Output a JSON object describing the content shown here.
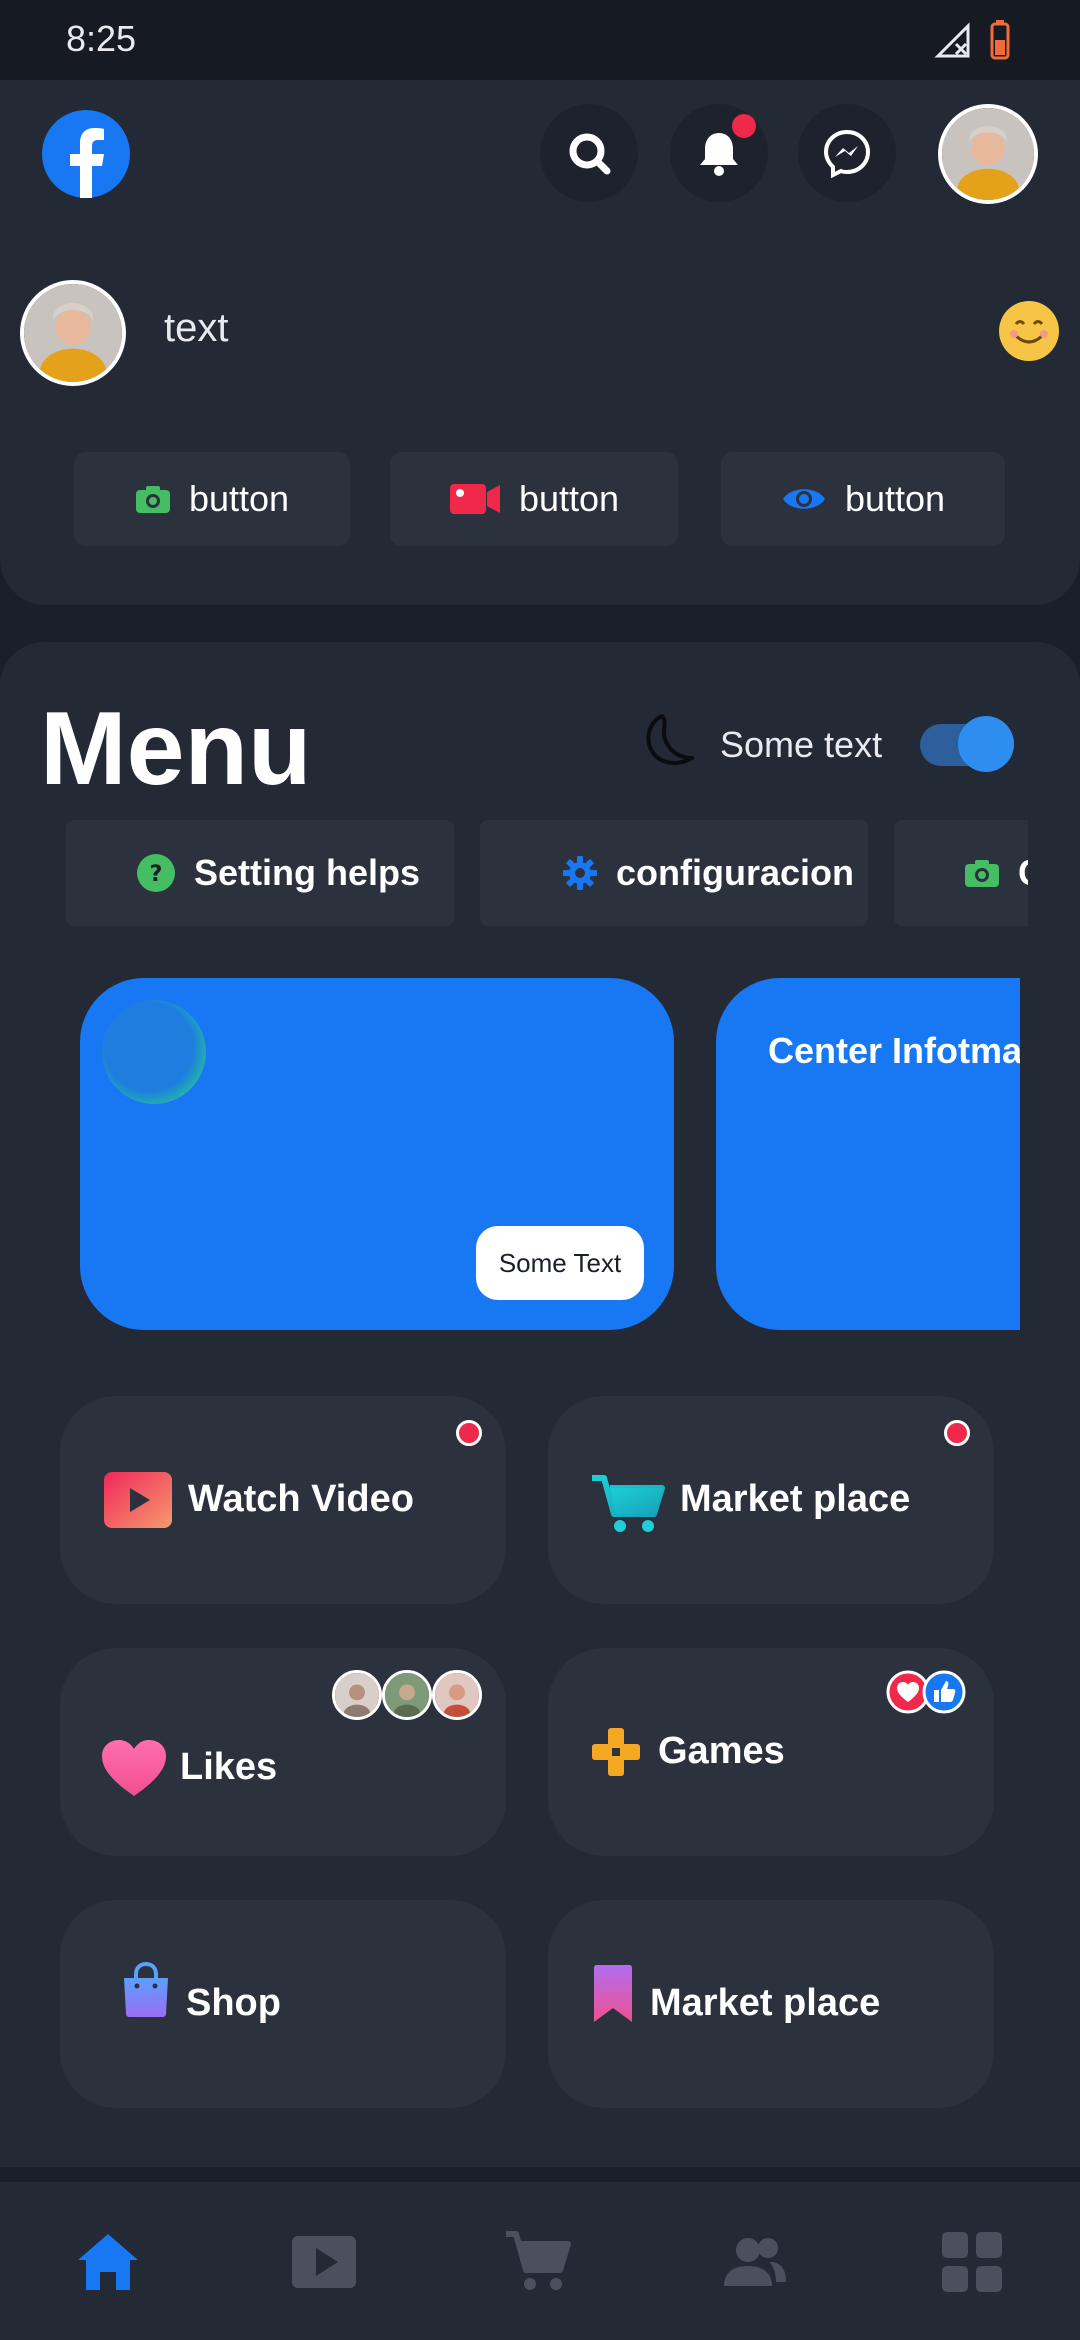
{
  "status_bar": {
    "time": "8:25"
  },
  "header": {
    "post_placeholder_text": "text",
    "actions": [
      {
        "label": "button",
        "icon": "camera-icon",
        "color": "#45bd62"
      },
      {
        "label": "button",
        "icon": "video-camera-icon",
        "color": "#f02849"
      },
      {
        "label": "button",
        "icon": "eye-icon",
        "color": "#1877f2"
      }
    ]
  },
  "menu": {
    "title": "Menu",
    "dark_mode_label": "Some text",
    "dark_mode_on": true,
    "chips": [
      {
        "label": "Setting helps",
        "icon": "help-icon"
      },
      {
        "label": "configuracion",
        "icon": "gear-icon"
      },
      {
        "label": "C",
        "icon": "camera-icon"
      }
    ],
    "banners": [
      {
        "button_label": "Some Text"
      },
      {
        "title": "Center Infotmat"
      }
    ],
    "tiles": [
      {
        "label": "Watch Video",
        "icon": "play-video-icon",
        "badge": true
      },
      {
        "label": "Market place",
        "icon": "shopping-cart-icon",
        "badge": true
      },
      {
        "label": "Likes",
        "icon": "heart-icon"
      },
      {
        "label": "Games",
        "icon": "game-controller-icon"
      },
      {
        "label": "Shop",
        "icon": "shopping-bag-icon"
      },
      {
        "label": "Market place",
        "icon": "bookmark-icon"
      }
    ]
  },
  "bottom_nav": {
    "items": [
      "home-icon",
      "video-icon",
      "cart-icon",
      "groups-icon",
      "menu-grid-icon"
    ],
    "active": "home-icon"
  },
  "colors": {
    "background": "#1b1f2a",
    "card": "#242936",
    "accent": "#1877f2",
    "notification": "#f0284a"
  }
}
